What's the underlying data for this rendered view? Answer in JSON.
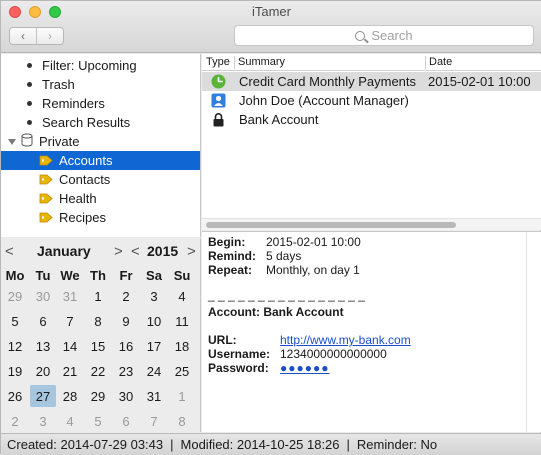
{
  "window": {
    "title": "iTamer"
  },
  "toolbar": {
    "back_glyph": "‹",
    "forward_glyph": "›",
    "search_placeholder": "Search"
  },
  "sidebar": {
    "items": [
      {
        "label": "Filter: Upcoming",
        "kind": "bullet"
      },
      {
        "label": "Trash",
        "kind": "bullet"
      },
      {
        "label": "Reminders",
        "kind": "bullet"
      },
      {
        "label": "Search Results",
        "kind": "bullet"
      },
      {
        "label": "Private",
        "kind": "group"
      },
      {
        "label": "Accounts",
        "kind": "tag",
        "selected": true
      },
      {
        "label": "Contacts",
        "kind": "tag"
      },
      {
        "label": "Health",
        "kind": "tag"
      },
      {
        "label": "Recipes",
        "kind": "tag"
      }
    ]
  },
  "calendar": {
    "month": "January",
    "year": "2015",
    "prev_glyph": "<",
    "next_glyph": ">",
    "weekdays": [
      "Mo",
      "Tu",
      "We",
      "Th",
      "Fr",
      "Sa",
      "Su"
    ],
    "weeks": [
      [
        "29",
        "30",
        "31",
        "1",
        "2",
        "3",
        "4"
      ],
      [
        "5",
        "6",
        "7",
        "8",
        "9",
        "10",
        "11"
      ],
      [
        "12",
        "13",
        "14",
        "15",
        "16",
        "17",
        "18"
      ],
      [
        "19",
        "20",
        "21",
        "22",
        "23",
        "24",
        "25"
      ],
      [
        "26",
        "27",
        "28",
        "29",
        "30",
        "31",
        "1"
      ],
      [
        "2",
        "3",
        "4",
        "5",
        "6",
        "7",
        "8"
      ]
    ],
    "today": "27"
  },
  "table": {
    "columns": [
      "Type",
      "Summary",
      "Date"
    ],
    "rows": [
      {
        "icon": "clock-icon",
        "summary": "Credit Card Monthly Payments",
        "date": "2015-02-01 10:00",
        "selected": true
      },
      {
        "icon": "contact-icon",
        "summary": "John Doe (Account Manager)",
        "date": ""
      },
      {
        "icon": "lock-icon",
        "summary": "Bank Account",
        "date": ""
      }
    ]
  },
  "detail": {
    "begin_label": "Begin:",
    "begin_value": "2015-02-01 10:00",
    "remind_label": "Remind:",
    "remind_value": "5 days",
    "repeat_label": "Repeat:",
    "repeat_value": "Monthly, on day 1",
    "separator": "_ _ _ _ _ _ _ _ _ _ _ _ _ _ _ _",
    "account_label": "Account:",
    "account_value": "Bank Account",
    "url_label": "URL:",
    "url_value": "http://www.my-bank.com",
    "username_label": "Username:",
    "username_value": "1234000000000000",
    "password_label": "Password:",
    "password_value": "●●●●●●"
  },
  "status": {
    "created": "Created: 2014-07-29 03:43",
    "modified": "Modified: 2014-10-25 18:26",
    "reminder": "Reminder: No",
    "divider": "|"
  },
  "colors": {
    "selection": "#1066d3",
    "tag": "#e8b500",
    "today": "#a6c6e0",
    "link": "#1a4ec8"
  }
}
